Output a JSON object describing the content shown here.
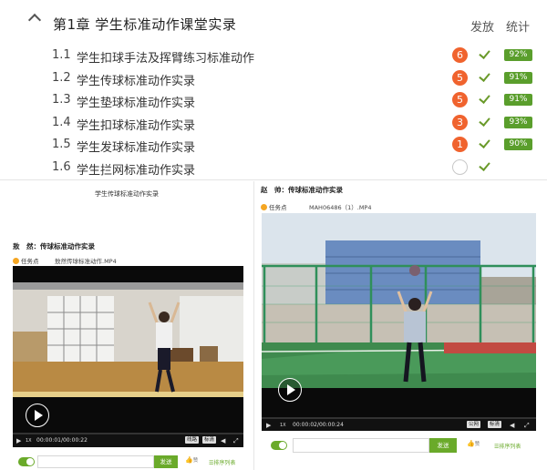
{
  "chapter": {
    "title": "第1章 学生标准动作课堂实录",
    "publish_label": "发放",
    "stats_label": "统计",
    "lessons": [
      {
        "num": "1.1",
        "title": "学生扣球手法及挥臂练习标准动作",
        "badge": "6",
        "pct": "92%"
      },
      {
        "num": "1.2",
        "title": "学生传球标准动作实录",
        "badge": "5",
        "pct": "91%"
      },
      {
        "num": "1.3",
        "title": "学生垫球标准动作实录",
        "badge": "5",
        "pct": "91%"
      },
      {
        "num": "1.4",
        "title": "学生扣球标准动作实录",
        "badge": "3",
        "pct": "93%"
      },
      {
        "num": "1.5",
        "title": "学生发球标准动作实录",
        "badge": "1",
        "pct": "90%"
      },
      {
        "num": "1.6",
        "title": "学生拦网标准动作实录",
        "badge": "",
        "pct": ""
      }
    ]
  },
  "left_pane": {
    "header": "学生传球标准动作实录",
    "student": "敖　然：传球标准动作实录",
    "task_label": "任务点",
    "file": "敖然传球标准动作.MP4",
    "time": "00:00:01/00:00:22",
    "btn_line": "线路",
    "btn_hd": "标清",
    "send_label": "发送",
    "like_label": "赞",
    "sort_label": "排序列表"
  },
  "right_pane": {
    "student": "赵　帅：传球标准动作实录",
    "task_label": "任务点",
    "file": "MAH06486（1）.MP4",
    "time": "00:00:02/00:00:24",
    "btn_line": "公网",
    "btn_hd": "标清",
    "send_label": "发送",
    "like_label": "赞",
    "sort_label": "排序列表"
  },
  "icons": {
    "play": "play-icon",
    "volume": "volume-icon",
    "fullscreen": "fullscreen-icon",
    "like": "thumbs-up-icon",
    "sort": "list-icon"
  }
}
